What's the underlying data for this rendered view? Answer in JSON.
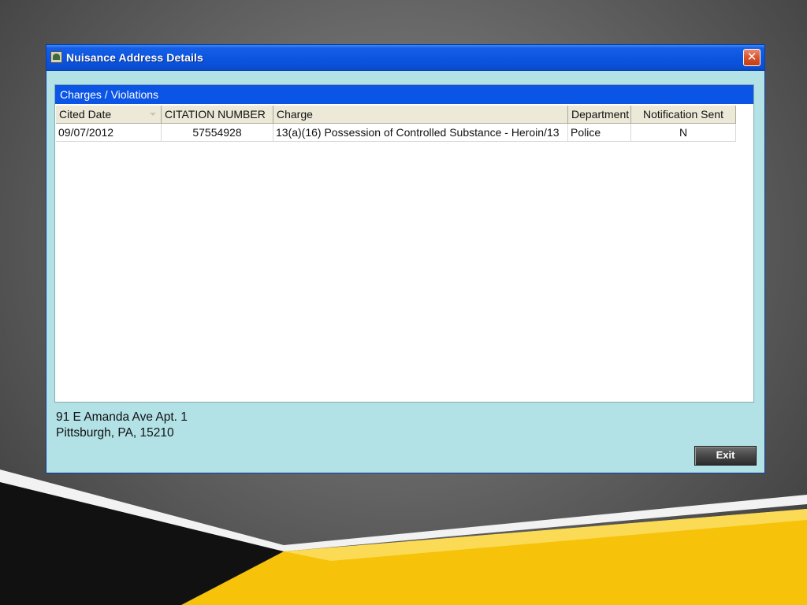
{
  "window": {
    "title": "Nuisance Address Details",
    "close_symbol": "✕"
  },
  "panel": {
    "header": "Charges / Violations",
    "columns": [
      "Cited Date",
      "CITATION NUMBER",
      "Charge",
      "Department",
      "Notification Sent"
    ],
    "rows": [
      {
        "cited_date": "09/07/2012",
        "citation_number": "57554928",
        "charge": "13(a)(16) Possession of Controlled Substance - Heroin/13",
        "department": "Police",
        "notification_sent": "N"
      }
    ]
  },
  "address": {
    "line1": "91 E Amanda Ave Apt. 1",
    "line2": "Pittsburgh, PA, 15210"
  },
  "buttons": {
    "exit_label": "Exit"
  },
  "colors": {
    "window_bg": "#b2e2e6",
    "titlebar_blue": "#0b55e0",
    "header_blue": "#0a55e6",
    "accent_yellow": "#f6c20a"
  },
  "icons": {
    "title_icon": "app-icon",
    "close_icon": "close-icon",
    "sort_icon": "sort-arrow-icon"
  }
}
